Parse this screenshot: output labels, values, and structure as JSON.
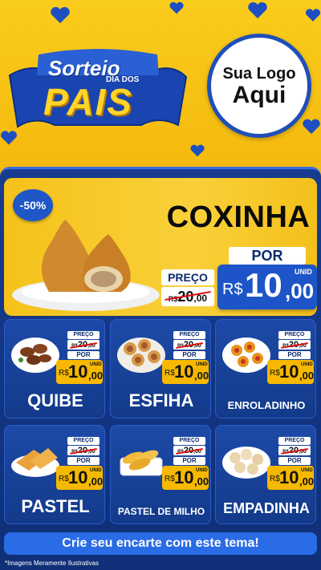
{
  "header": {
    "logo_line1": "Sorteio",
    "logo_line2": "DIA DOS",
    "logo_line3": "PAIS",
    "brand_line1": "Sua Logo",
    "brand_line2": "Aqui"
  },
  "hero": {
    "discount": "-50%",
    "title": "COXINHA",
    "preco_label": "PREÇO",
    "old_currency": "R$",
    "old_int": "20",
    "old_cents": ",00",
    "por_label": "POR",
    "currency": "R$",
    "price_int": "10",
    "price_cents": ",00",
    "unit": "UNID"
  },
  "products": [
    {
      "name": "QUIBE",
      "preco_label": "PREÇO",
      "old_currency": "R$",
      "old_int": "20",
      "old_cents": ",00",
      "por_label": "POR",
      "currency": "R$",
      "price_int": "10",
      "price_cents": ",00",
      "unit": "UNID"
    },
    {
      "name": "ESFIHA",
      "preco_label": "PREÇO",
      "old_currency": "R$",
      "old_int": "20",
      "old_cents": ",00",
      "por_label": "POR",
      "currency": "R$",
      "price_int": "10",
      "price_cents": ",00",
      "unit": "UNID"
    },
    {
      "name": "ENROLADINHO",
      "preco_label": "PREÇO",
      "old_currency": "R$",
      "old_int": "20",
      "old_cents": ",00",
      "por_label": "POR",
      "currency": "R$",
      "price_int": "10",
      "price_cents": ",00",
      "unit": "UNID"
    },
    {
      "name": "PASTEL",
      "preco_label": "PREÇO",
      "old_currency": "R$",
      "old_int": "20",
      "old_cents": ",00",
      "por_label": "POR",
      "currency": "R$",
      "price_int": "10",
      "price_cents": ",00",
      "unit": "UNID"
    },
    {
      "name": "PASTEL DE MILHO",
      "preco_label": "PREÇO",
      "old_currency": "R$",
      "old_int": "20",
      "old_cents": ",00",
      "por_label": "POR",
      "currency": "R$",
      "price_int": "10",
      "price_cents": ",00",
      "unit": "UNID"
    },
    {
      "name": "EMPADINHA",
      "preco_label": "PREÇO",
      "old_currency": "R$",
      "old_int": "20",
      "old_cents": ",00",
      "por_label": "POR",
      "currency": "R$",
      "price_int": "10",
      "price_cents": ",00",
      "unit": "UNID"
    }
  ],
  "cta": "Crie seu encarte com este tema!",
  "footnote": "*Imagens Meramente Ilustrativas",
  "colors": {
    "yellow": "#f5c21a",
    "navy": "#133a8a",
    "blue": "#1d55c9",
    "price_yellow": "#f6b800"
  },
  "icons": [
    "heart-icon",
    "coxinha-image",
    "quibe-image",
    "esfiha-image",
    "enroladinho-image",
    "pastel-image",
    "pastel-de-milho-image",
    "empadinha-image"
  ]
}
